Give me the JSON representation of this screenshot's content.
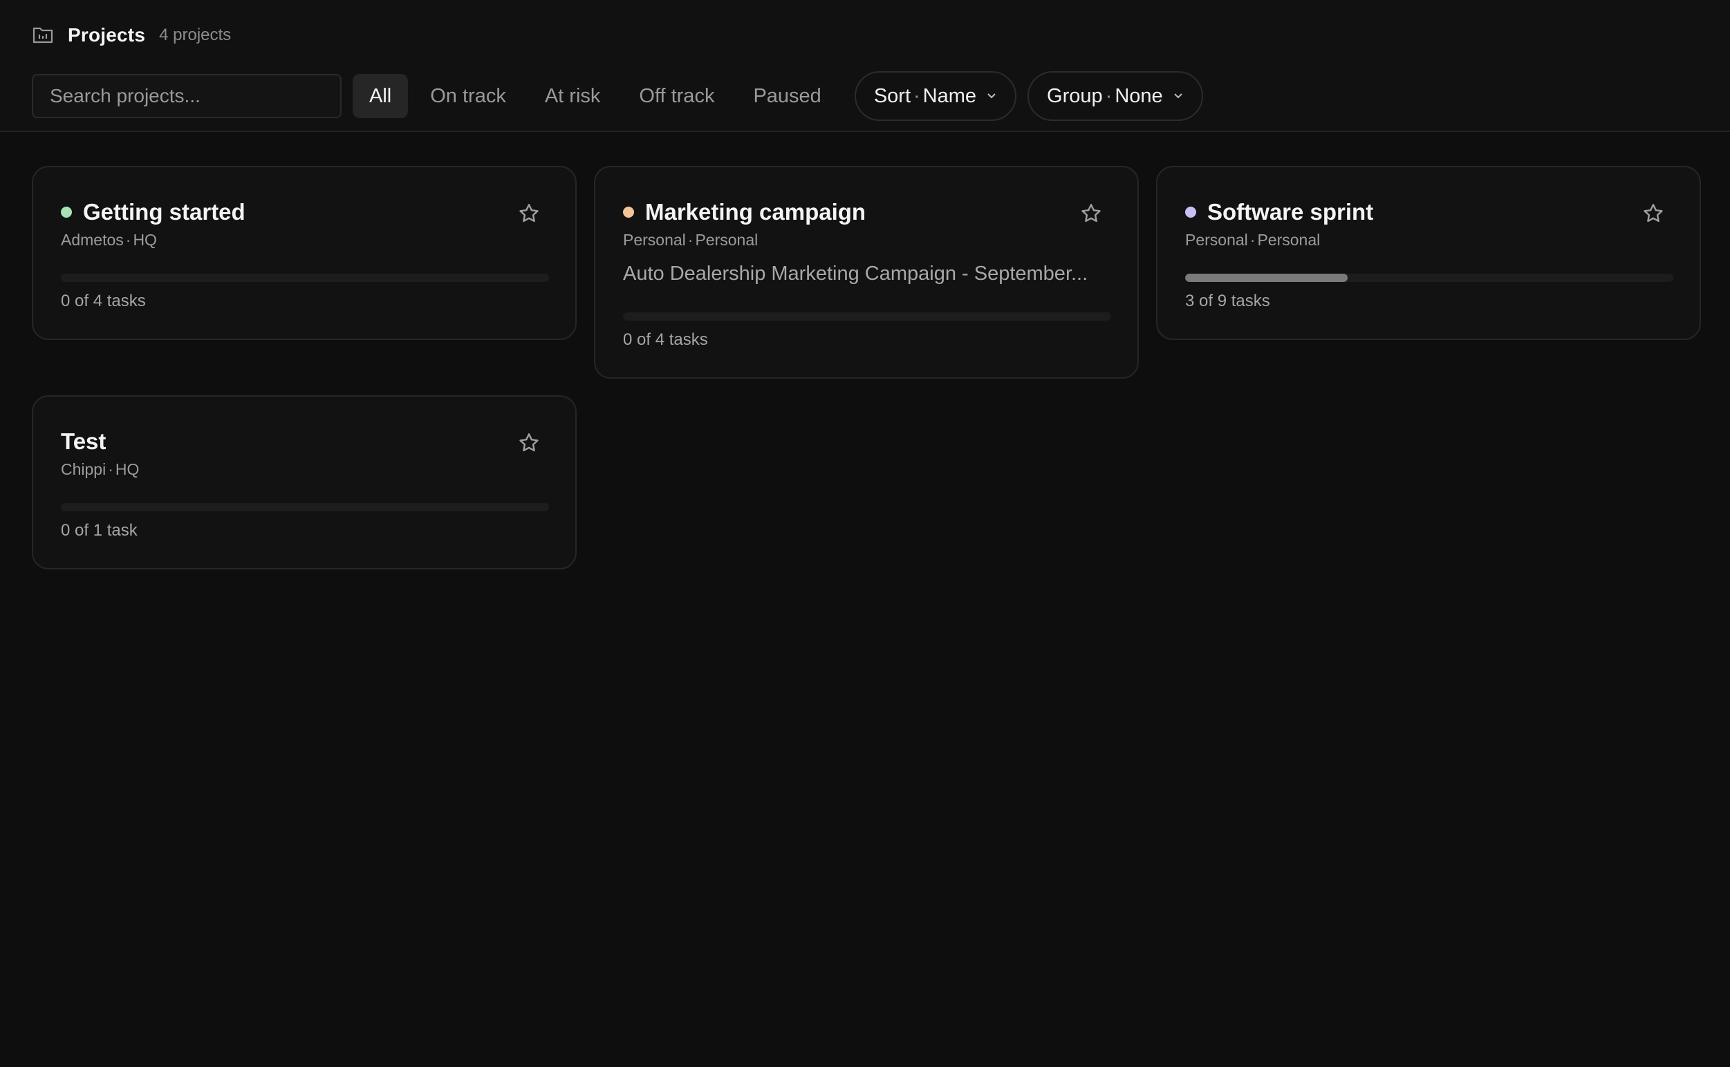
{
  "header": {
    "title": "Projects",
    "count": "4 projects"
  },
  "toolbar": {
    "search_placeholder": "Search projects...",
    "filters": [
      "All",
      "On track",
      "At risk",
      "Off track",
      "Paused"
    ],
    "active_filter": "All",
    "sort": {
      "label": "Sort",
      "value": "Name"
    },
    "group": {
      "label": "Group",
      "value": "None"
    }
  },
  "projects": [
    {
      "name": "Getting started",
      "status_color": "#a8e0b8",
      "owner": "Admetos",
      "team": "HQ",
      "description": "",
      "progress": 0,
      "tasks": "0 of 4 tasks"
    },
    {
      "name": "Marketing campaign",
      "status_color": "#f2c49a",
      "owner": "Personal",
      "team": "Personal",
      "description": "Auto Dealership Marketing Campaign - September...",
      "progress": 0,
      "tasks": "0 of 4 tasks"
    },
    {
      "name": "Software sprint",
      "status_color": "#c8c0f5",
      "owner": "Personal",
      "team": "Personal",
      "description": "",
      "progress": 0.333,
      "tasks": "3 of 9 tasks"
    },
    {
      "name": "Test",
      "status_color": "",
      "owner": "Chippi",
      "team": "HQ",
      "description": "",
      "progress": 0,
      "tasks": "0 of 1 task"
    }
  ],
  "icons": {
    "folder": "folder-icon",
    "star": "star-icon",
    "chevron": "chevron-down-icon"
  }
}
